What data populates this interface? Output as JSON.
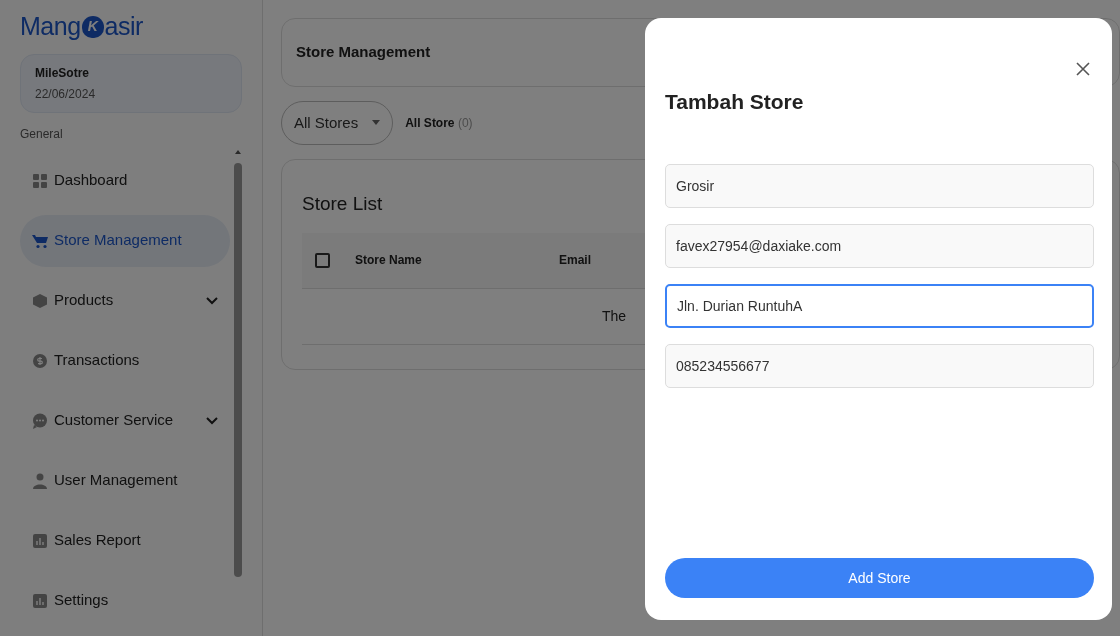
{
  "logo": {
    "before": "Mang",
    "mark": "K",
    "after": "asir"
  },
  "store_card": {
    "name": "MileSotre",
    "date": "22/06/2024"
  },
  "sidebar": {
    "section": "General",
    "items": [
      {
        "kind": "grid",
        "label": "Dashboard",
        "selected": false
      },
      {
        "kind": "cart",
        "label": "Store Management",
        "selected": true
      },
      {
        "kind": "box",
        "label": "Products",
        "selected": false,
        "expanded": false
      },
      {
        "kind": "dollar",
        "label": "Transactions",
        "selected": false
      },
      {
        "kind": "chat",
        "label": "Customer Service",
        "selected": false,
        "expanded": false
      },
      {
        "kind": "user",
        "label": "User Management",
        "selected": false
      },
      {
        "kind": "chart",
        "label": "Sales Report",
        "selected": false
      },
      {
        "kind": "chart",
        "label": "Settings",
        "selected": false
      }
    ]
  },
  "header": {
    "title": "Store Management"
  },
  "filter": {
    "value": "All Stores",
    "label": "All Store",
    "count": "(0)"
  },
  "store_list": {
    "title": "Store List",
    "columns": [
      "Store Name",
      "Email"
    ],
    "select_all": {
      "checked": false
    },
    "empty_text": "The"
  },
  "modal": {
    "title": "Tambah Store",
    "fields": [
      {
        "value": "Grosir",
        "focused": false
      },
      {
        "value": "favex27954@daxiake.com",
        "focused": false
      },
      {
        "value": "Jln. Durian RuntuhA",
        "focused": true
      },
      {
        "value": "085234556677",
        "focused": false
      }
    ],
    "submit": "Add Store"
  }
}
